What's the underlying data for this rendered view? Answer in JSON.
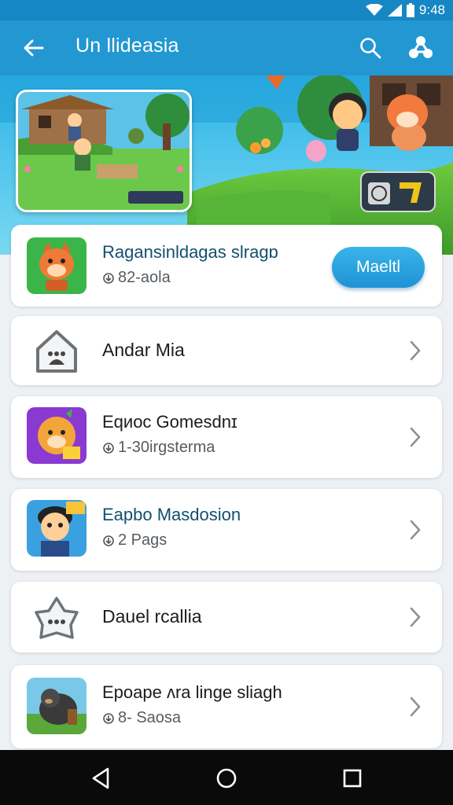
{
  "status_bar": {
    "time": "9:48"
  },
  "app_bar": {
    "title": "Un llideasia"
  },
  "featured": {
    "title": "Ragansinldagas slragɒ",
    "subtitle": "82-aola",
    "action_label": "Maeltl"
  },
  "list": {
    "items": [
      {
        "title": "Andar Mia"
      },
      {
        "title": "Eqиoc Gomesdnɪ",
        "subtitle": "1-30irgsterma"
      },
      {
        "title": "Eapbo Masdosion",
        "subtitle": "2 Pags"
      },
      {
        "title": "Dauel rcallia"
      },
      {
        "title": "Epoape ʌra linge sliagh",
        "subtitle": "8- Saosa"
      }
    ]
  },
  "icons": [
    "back-arrow-icon",
    "search-icon",
    "share-icon",
    "wifi-icon",
    "signal-icon",
    "battery-icon",
    "chevron-right-icon",
    "download-icon",
    "house-icon",
    "star-icon",
    "nav-back-icon",
    "nav-home-icon",
    "nav-recents-icon"
  ],
  "colors": {
    "app_bar": "#2397d2",
    "status_bar": "#1687c4",
    "accent": "#1e93d5",
    "background": "#eef1f4"
  }
}
